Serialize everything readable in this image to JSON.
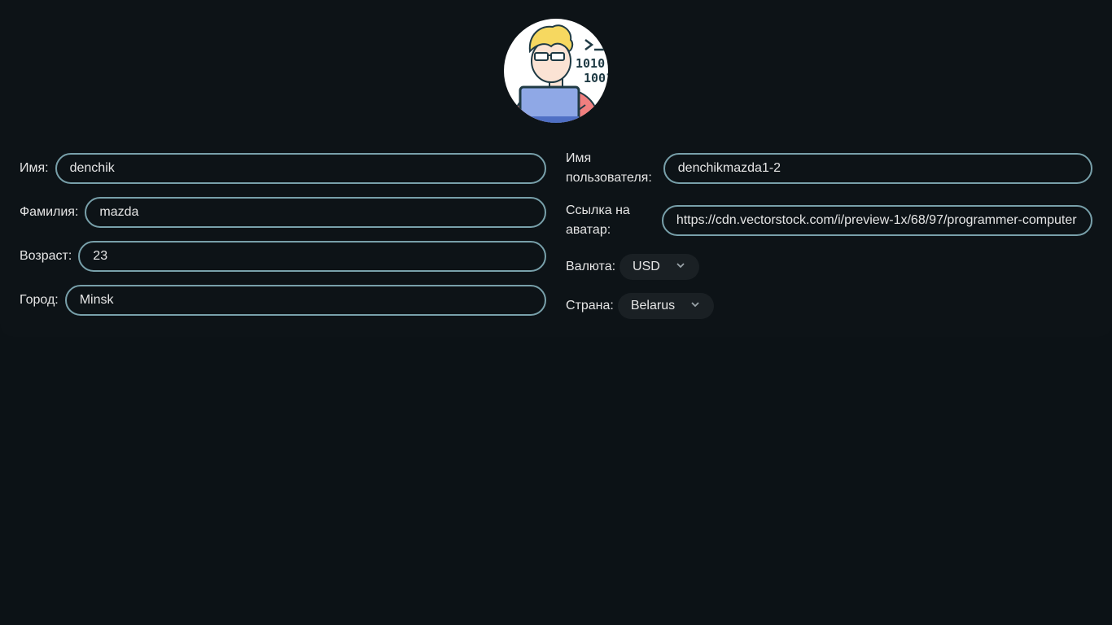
{
  "avatar": {
    "icon": "programmer-avatar"
  },
  "form": {
    "first_name": {
      "label": "Имя:",
      "value": "denchik"
    },
    "last_name": {
      "label": "Фамилия:",
      "value": "mazda"
    },
    "age": {
      "label": "Возраст:",
      "value": "23"
    },
    "city": {
      "label": "Город:",
      "value": "Minsk"
    },
    "username": {
      "label_line1": "Имя",
      "label_line2": "пользователя:",
      "value": "denchikmazda1-2"
    },
    "avatar_link": {
      "label_line1": "Ссылка на",
      "label_line2": "аватар:",
      "value": "https://cdn.vectorstock.com/i/preview-1x/68/97/programmer-computer"
    },
    "currency": {
      "label": "Валюта:",
      "value": "USD"
    },
    "country": {
      "label": "Страна:",
      "value": "Belarus"
    }
  },
  "colors": {
    "background": "#0c1216",
    "input_border": "#78a0aa",
    "select_bg": "#1a2024",
    "text": "#e6e6e6"
  }
}
